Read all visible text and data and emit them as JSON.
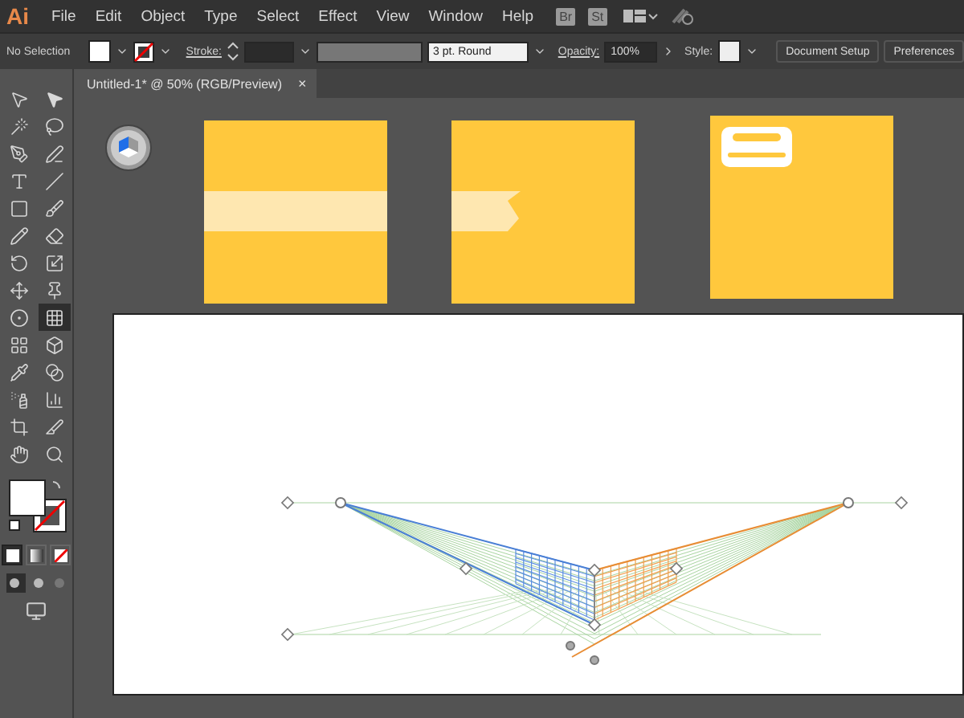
{
  "app": {
    "logo": "Ai",
    "menu": [
      "File",
      "Edit",
      "Object",
      "Type",
      "Select",
      "Effect",
      "View",
      "Window",
      "Help"
    ],
    "bridge_button": "Br",
    "stock_button": "St"
  },
  "control_bar": {
    "selection_label": "No Selection",
    "stroke_label": "Stroke:",
    "stroke_profile": "3 pt. Round",
    "opacity_label": "Opacity:",
    "opacity_value": "100%",
    "style_label": "Style:",
    "buttons": [
      "Document Setup",
      "Preferences"
    ]
  },
  "document_tab": {
    "title": "Untitled-1* @ 50% (RGB/Preview)",
    "close": "×"
  },
  "tools": [
    {
      "selected": false
    },
    {
      "selected": false
    },
    {
      "selected": false
    },
    {
      "selected": false
    },
    {
      "selected": false
    },
    {
      "selected": false
    },
    {
      "selected": false
    },
    {
      "selected": false
    },
    {
      "selected": false
    },
    {
      "selected": false
    },
    {
      "selected": false
    },
    {
      "selected": false
    },
    {
      "selected": false
    },
    {
      "selected": false
    },
    {
      "selected": false
    },
    {
      "selected": false
    },
    {
      "selected": false
    },
    {
      "selected": true
    },
    {
      "selected": false
    },
    {
      "selected": false
    },
    {
      "selected": false
    },
    {
      "selected": false
    },
    {
      "selected": false
    },
    {
      "selected": false
    },
    {
      "selected": false
    },
    {
      "selected": false
    },
    {
      "selected": false
    },
    {
      "selected": false
    }
  ],
  "color_modes": [
    {
      "kind": "color",
      "selected": true
    },
    {
      "kind": "gradient",
      "selected": false
    },
    {
      "kind": "none",
      "selected": false
    }
  ],
  "artboards": [
    {
      "kind": "band"
    },
    {
      "kind": "ribbon"
    },
    {
      "kind": "badge"
    }
  ]
}
